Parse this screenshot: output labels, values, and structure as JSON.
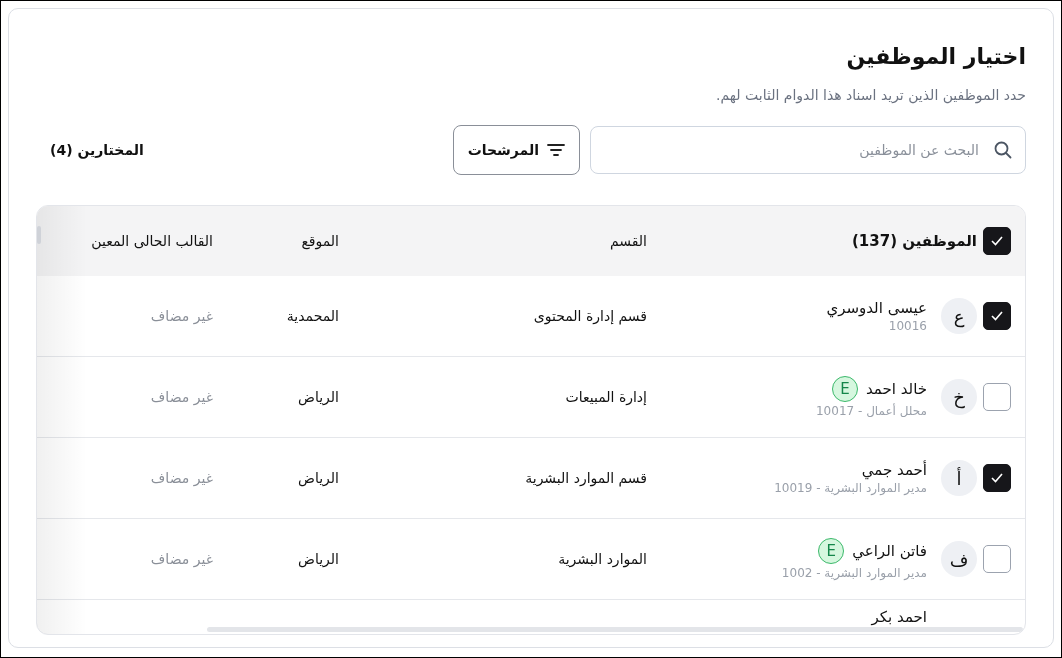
{
  "title": "اختيار الموظفين",
  "subtitle": "حدد الموظفين الذين تريد اسناد هذا الدوام الثابت لهم.",
  "search": {
    "placeholder": "البحث عن الموظفين"
  },
  "filters_button": "المرشحات",
  "selected_count": "المختارين (4)",
  "table": {
    "select_all_checked": true,
    "columns": [
      "الموظفين (137)",
      "القسم",
      "الموقع",
      "القالب الحالى المعين"
    ],
    "rows": [
      {
        "initial": "ع",
        "name": "عيسى الدوسري",
        "sub": "10016",
        "badge": "",
        "checked": true,
        "department": "قسم إدارة المحتوى",
        "location": "المحمدية",
        "template": "غير مضاف"
      },
      {
        "initial": "خ",
        "name": "خالد احمد",
        "sub": "محلل أعمال - 10017",
        "badge": "E",
        "checked": false,
        "department": "إدارة المبيعات",
        "location": "الرياض",
        "template": "غير مضاف"
      },
      {
        "initial": "أ",
        "name": "أحمد جمي",
        "sub": "مدير الموارد البشرية - 10019",
        "badge": "",
        "checked": true,
        "department": "قسم الموارد البشرية",
        "location": "الرياض",
        "template": "غير مضاف"
      },
      {
        "initial": "ف",
        "name": "فاتن الراعي",
        "sub": "مدير الموارد البشرية - 1002",
        "badge": "E",
        "checked": false,
        "department": "الموارد البشرية",
        "location": "الرياض",
        "template": "غير مضاف"
      },
      {
        "name": "احمد بكر"
      }
    ]
  }
}
